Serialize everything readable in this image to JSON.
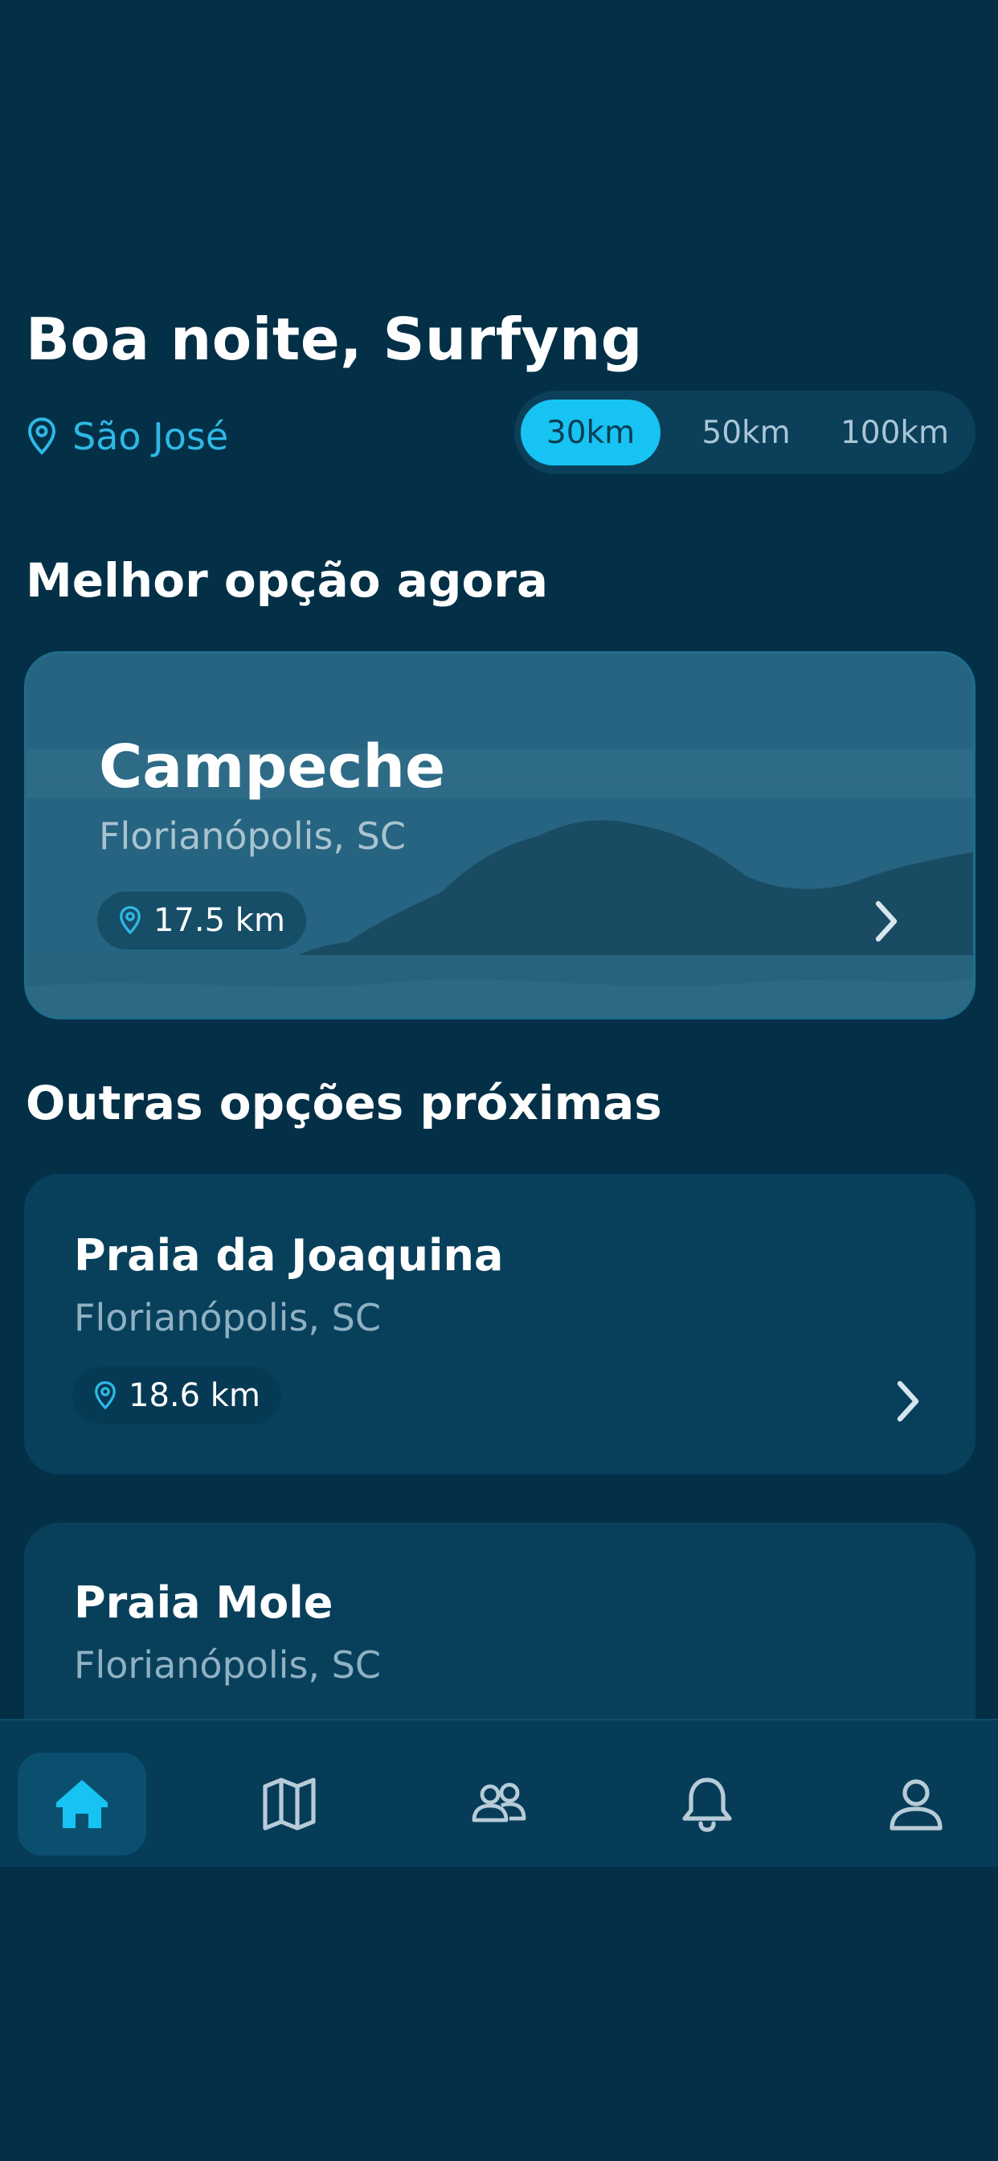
{
  "header": {
    "greeting": "Boa noite, Surfyng",
    "location": "São José"
  },
  "radius_filter": {
    "options": [
      "30km",
      "50km",
      "100km"
    ],
    "selected": "30km"
  },
  "best": {
    "section_title": "Melhor opção agora",
    "name": "Campeche",
    "region": "Florianópolis, SC",
    "distance": "17.5 km"
  },
  "others": {
    "section_title": "Outras opções próximas",
    "items": [
      {
        "name": "Praia da Joaquina",
        "region": "Florianópolis, SC",
        "distance": "18.6 km"
      },
      {
        "name": "Praia Mole",
        "region": "Florianópolis, SC"
      }
    ]
  },
  "colors": {
    "background": "#033047",
    "accent": "#16c3f2",
    "card": "#08405c",
    "location_text": "#2fb8e6"
  },
  "tabbar": {
    "tabs": [
      {
        "icon": "home-icon",
        "active": true
      },
      {
        "icon": "map-icon",
        "active": false
      },
      {
        "icon": "community-icon",
        "active": false
      },
      {
        "icon": "bell-icon",
        "active": false
      },
      {
        "icon": "profile-icon",
        "active": false
      }
    ]
  }
}
